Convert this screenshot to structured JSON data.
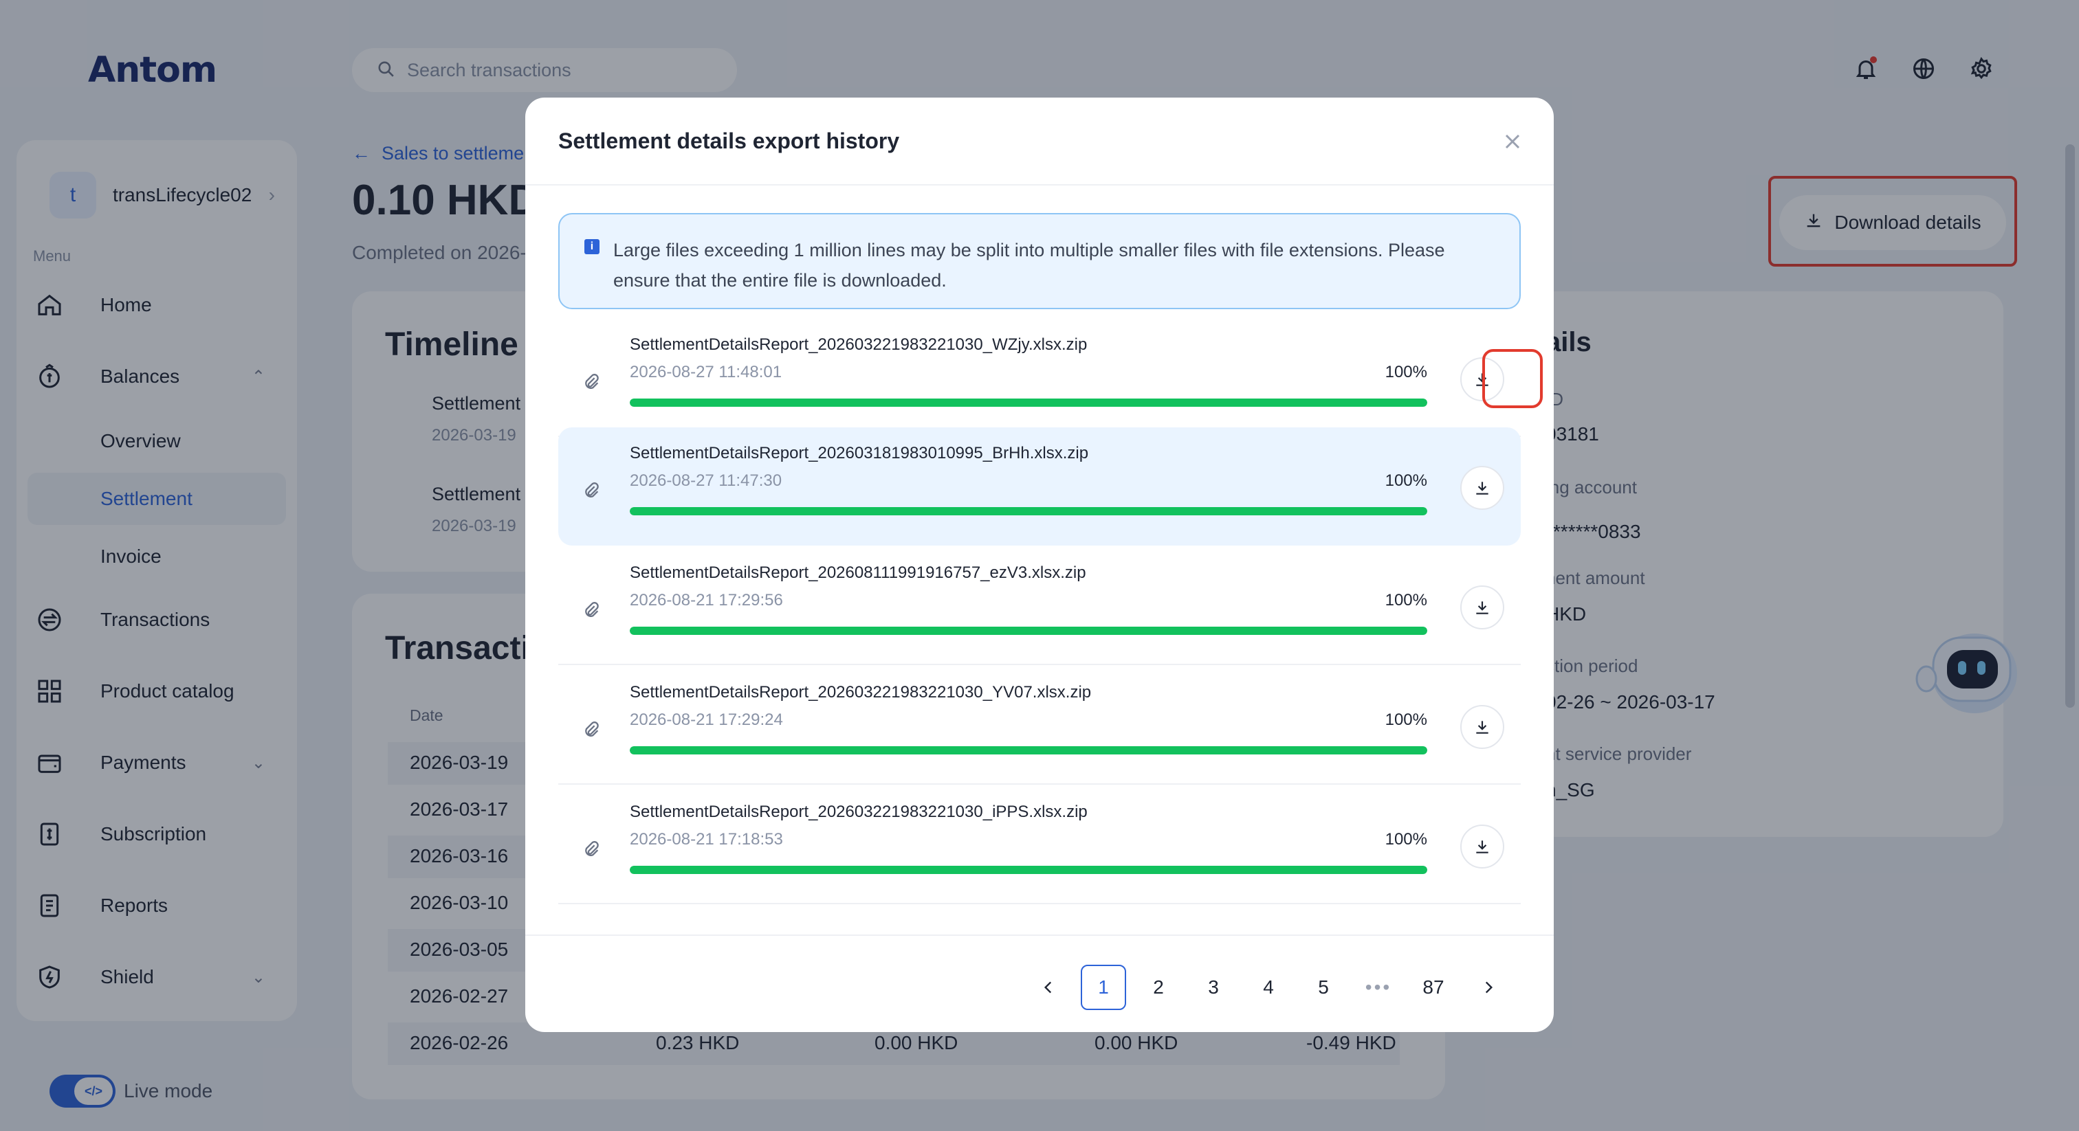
{
  "app": {
    "logo": "Antom",
    "search_placeholder": "Search transactions"
  },
  "sidebar": {
    "account_initial": "t",
    "account_name": "transLifecycle02",
    "menu_label": "Menu",
    "items": [
      {
        "label": "Home",
        "icon": "home-icon"
      },
      {
        "label": "Balances",
        "icon": "balances-icon"
      },
      {
        "label": "Overview"
      },
      {
        "label": "Settlement"
      },
      {
        "label": "Invoice"
      },
      {
        "label": "Transactions",
        "icon": "transactions-icon"
      },
      {
        "label": "Product catalog",
        "icon": "product-catalog-icon"
      },
      {
        "label": "Payments",
        "icon": "payments-icon"
      },
      {
        "label": "Subscription",
        "icon": "subscription-icon"
      },
      {
        "label": "Reports",
        "icon": "reports-icon"
      },
      {
        "label": "Shield",
        "icon": "shield-icon"
      }
    ],
    "live_mode_label": "Live mode",
    "live_mode_toggle": "</>"
  },
  "page": {
    "breadcrumb": "Sales to settleme",
    "amount": "0.10 HKD",
    "completed": "Completed on 2026-",
    "download_details": "Download details",
    "timeline": {
      "title": "Timeline",
      "items": [
        {
          "label": "Settlement",
          "date": "2026-03-19"
        },
        {
          "label": "Settlement",
          "date": "2026-03-19"
        }
      ]
    },
    "transactions": {
      "title": "Transacti",
      "date_header": "Date",
      "rows": [
        {
          "date": "2026-03-19"
        },
        {
          "date": "2026-03-17"
        },
        {
          "date": "2026-03-16"
        },
        {
          "date": "2026-03-10"
        },
        {
          "date": "2026-03-05"
        },
        {
          "date": "2026-02-27"
        },
        {
          "date": "2026-02-26",
          "c1": "0.23 HKD",
          "c2": "0.00 HKD",
          "c3": "0.00 HKD",
          "c4": "-0.49 HKD"
        }
      ]
    },
    "details": {
      "title": "ails",
      "fields": [
        {
          "label": "ID",
          "value": "03181"
        },
        {
          "label": "ing account",
          "value": "*******0833"
        },
        {
          "label": "nent amount",
          "value": "HKD"
        },
        {
          "label": "ction period",
          "value": "02-26 ~ 2026-03-17"
        },
        {
          "label": "nt service provider",
          "value": "n_SG"
        }
      ]
    }
  },
  "modal": {
    "title": "Settlement details export history",
    "info_line1": "Large files exceeding 1 million lines may be split into multiple smaller files with file extensions. Please",
    "info_line2": "ensure that the entire file is downloaded.",
    "files": [
      {
        "name": "SettlementDetailsReport_20260322198322103​0_WZjy.xlsx.zip",
        "date": "2026-08-27 11:48:01",
        "progress": "100%"
      },
      {
        "name": "SettlementDetailsReport_202603181983010995_BrHh.xlsx.zip",
        "date": "2026-08-27 11:47:30",
        "progress": "100%"
      },
      {
        "name": "SettlementDetailsReport_202608111991916757_ezV3.xlsx.zip",
        "date": "2026-08-21 17:29:56",
        "progress": "100%"
      },
      {
        "name": "SettlementDetailsReport_202603221983221030_YV07.xlsx.zip",
        "date": "2026-08-21 17:29:24",
        "progress": "100%"
      },
      {
        "name": "SettlementDetailsReport_202603221983221030_iPPS.xlsx.zip",
        "date": "2026-08-21 17:18:53",
        "progress": "100%"
      }
    ],
    "pagination": {
      "pages": [
        "1",
        "2",
        "3",
        "4",
        "5"
      ],
      "ellipsis": "•••",
      "last": "87",
      "current": "1"
    }
  },
  "colors": {
    "accent": "#2d63d8",
    "progress": "#12c15d",
    "highlight_frame": "#e23b2e"
  }
}
